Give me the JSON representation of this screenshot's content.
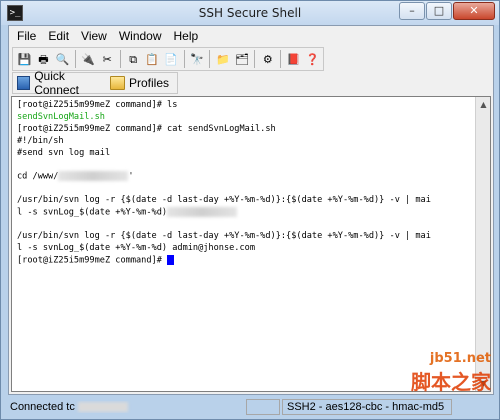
{
  "window": {
    "title": "SSH Secure Shell",
    "app_icon": "ssh-terminal-icon",
    "controls": {
      "minimize": "–",
      "maximize": "□",
      "close": "✕"
    }
  },
  "menubar": {
    "items": [
      "File",
      "Edit",
      "View",
      "Window",
      "Help"
    ]
  },
  "toolbar": {
    "buttons": [
      {
        "name": "save-icon",
        "glyph": "💾"
      },
      {
        "name": "print-icon",
        "glyph": "🖶"
      },
      {
        "name": "print-preview-icon",
        "glyph": "🔍"
      },
      {
        "name": "connect-icon",
        "glyph": "🔌"
      },
      {
        "name": "disconnect-icon",
        "glyph": "✂"
      },
      {
        "name": "copy-icon",
        "glyph": "⧉"
      },
      {
        "name": "paste-icon",
        "glyph": "📋"
      },
      {
        "name": "paste-special-icon",
        "glyph": "📄"
      },
      {
        "name": "find-icon",
        "glyph": "🔭"
      },
      {
        "name": "file-transfer-icon",
        "glyph": "📁"
      },
      {
        "name": "new-window-icon",
        "glyph": "🗂"
      },
      {
        "name": "settings-icon",
        "glyph": "⚙"
      },
      {
        "name": "help-book-icon",
        "glyph": "📕"
      },
      {
        "name": "context-help-icon",
        "glyph": "❓"
      }
    ]
  },
  "toolbar2": {
    "quick_connect": "Quick Connect",
    "profiles": "Profiles"
  },
  "terminal": {
    "lines": [
      {
        "text": "[root@iZ25i5m99meZ command]# ls",
        "color": "#000000"
      },
      {
        "text": "sendSvnLogMail.sh",
        "color": "#18a618"
      },
      {
        "text": "[root@iZ25i5m99meZ command]# cat sendSvnLogMail.sh",
        "color": "#000000"
      },
      {
        "text": "#!/bin/sh",
        "color": "#000000"
      },
      {
        "text": "#send svn log mail",
        "color": "#000000"
      },
      {
        "text": "",
        "color": "#000000"
      },
      {
        "text": "cd /www/",
        "suffix": "'",
        "redacted": true,
        "color": "#000000"
      },
      {
        "text": "",
        "color": "#000000"
      },
      {
        "text": "/usr/bin/svn log -r {$(date -d last-day +%Y-%m-%d)}:{$(date +%Y-%m-%d)} -v | mai",
        "color": "#000000"
      },
      {
        "text": "l -s svnLog_$(date +%Y-%m-%d)",
        "redacted": true,
        "color": "#000000"
      },
      {
        "text": "",
        "color": "#000000"
      },
      {
        "text": "/usr/bin/svn log -r {$(date -d last-day +%Y-%m-%d)}:{$(date +%Y-%m-%d)} -v | mai",
        "color": "#000000"
      },
      {
        "text": "l -s svnLog_$(date +%Y-%m-%d) admin@jhonse.com",
        "color": "#000000"
      },
      {
        "text": "[root@iZ25i5m99meZ command]# ",
        "cursor": true,
        "color": "#000000"
      }
    ]
  },
  "statusbar": {
    "connection": "Connected tc",
    "protocol": "SSH2 - aes128-cbc - hmac-md5"
  },
  "watermark": {
    "line1": "jb51.net",
    "line2": "脚本之家"
  }
}
